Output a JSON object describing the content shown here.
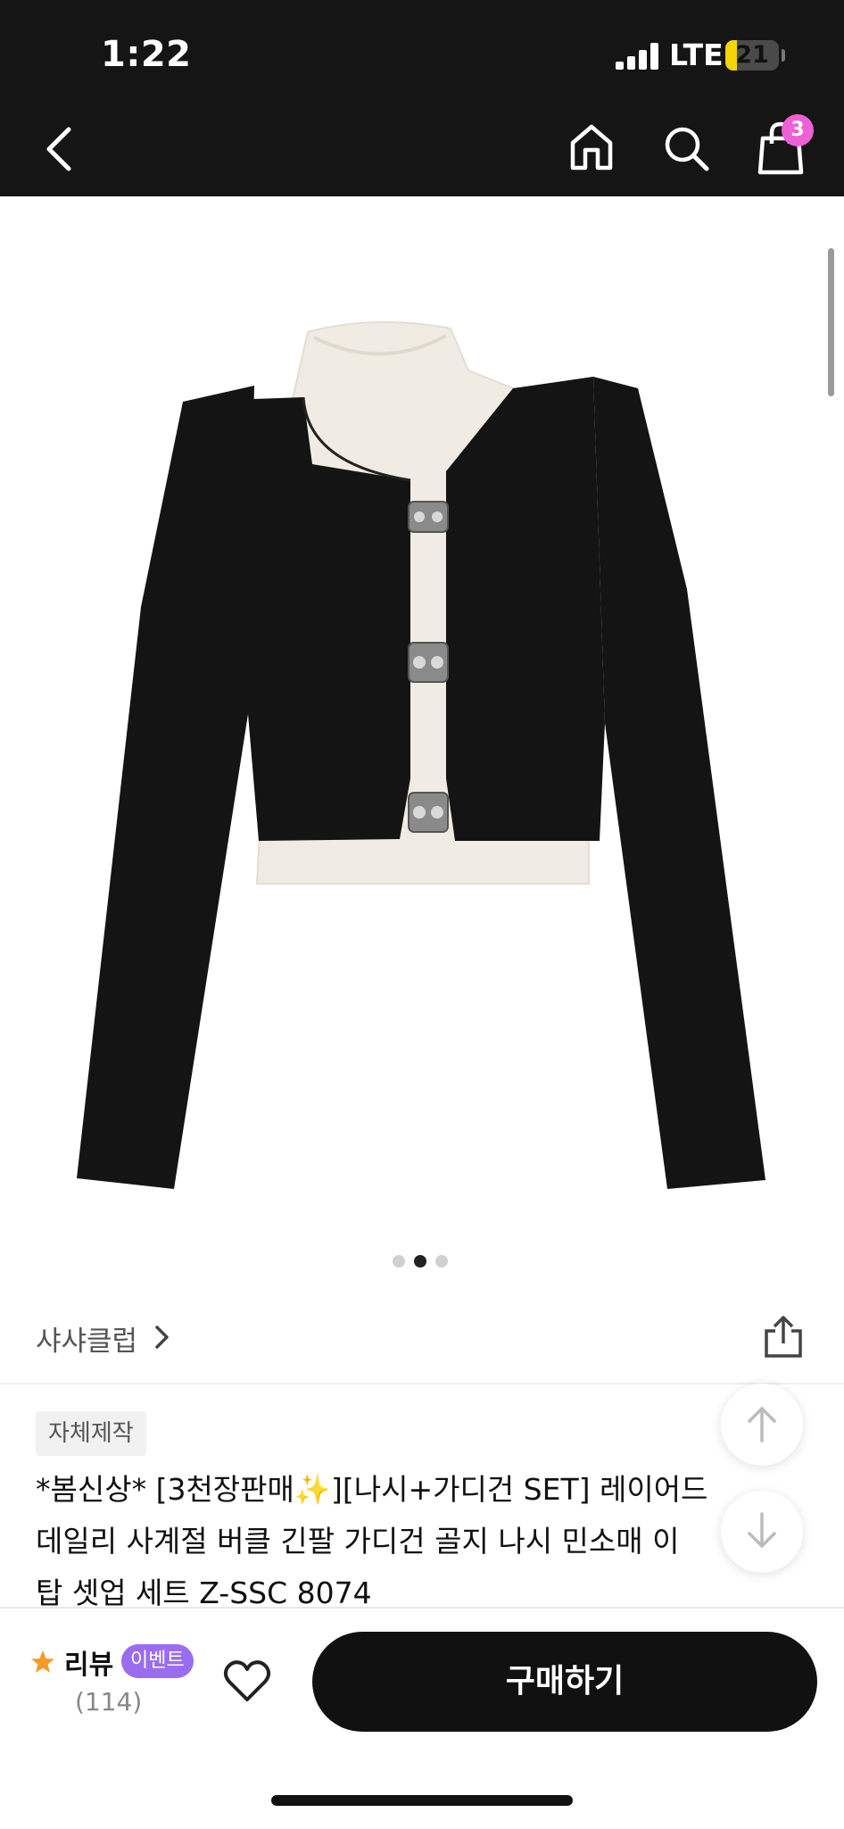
{
  "status_bar": {
    "time": "1:22",
    "network": "LTE",
    "battery": "21",
    "battery_level": 0.21
  },
  "header": {
    "icons": [
      "back-icon",
      "home-icon",
      "search-icon",
      "shopping-bag-icon"
    ],
    "cart_count": "3",
    "badge_color": "#ee5fd8"
  },
  "gallery": {
    "page_count": 3,
    "active_page": 2
  },
  "brand": {
    "name": "샤샤클럽"
  },
  "product": {
    "tag": "자체제작",
    "title": "*봄신상* [3천장판매✨][나시+가디건 SET] 레이어드\n데일리 사계절 버클 긴팔 가디건 골지 나시 민소매 이\n탑 셋업 세트 Z-SSC 8074"
  },
  "bottom_bar": {
    "review_label": "리뷰",
    "event_label": "이벤트",
    "review_count": "(114)",
    "buy_label": "구매하기",
    "accent_star": "#f59a23",
    "event_color": "#9b6cf0"
  }
}
